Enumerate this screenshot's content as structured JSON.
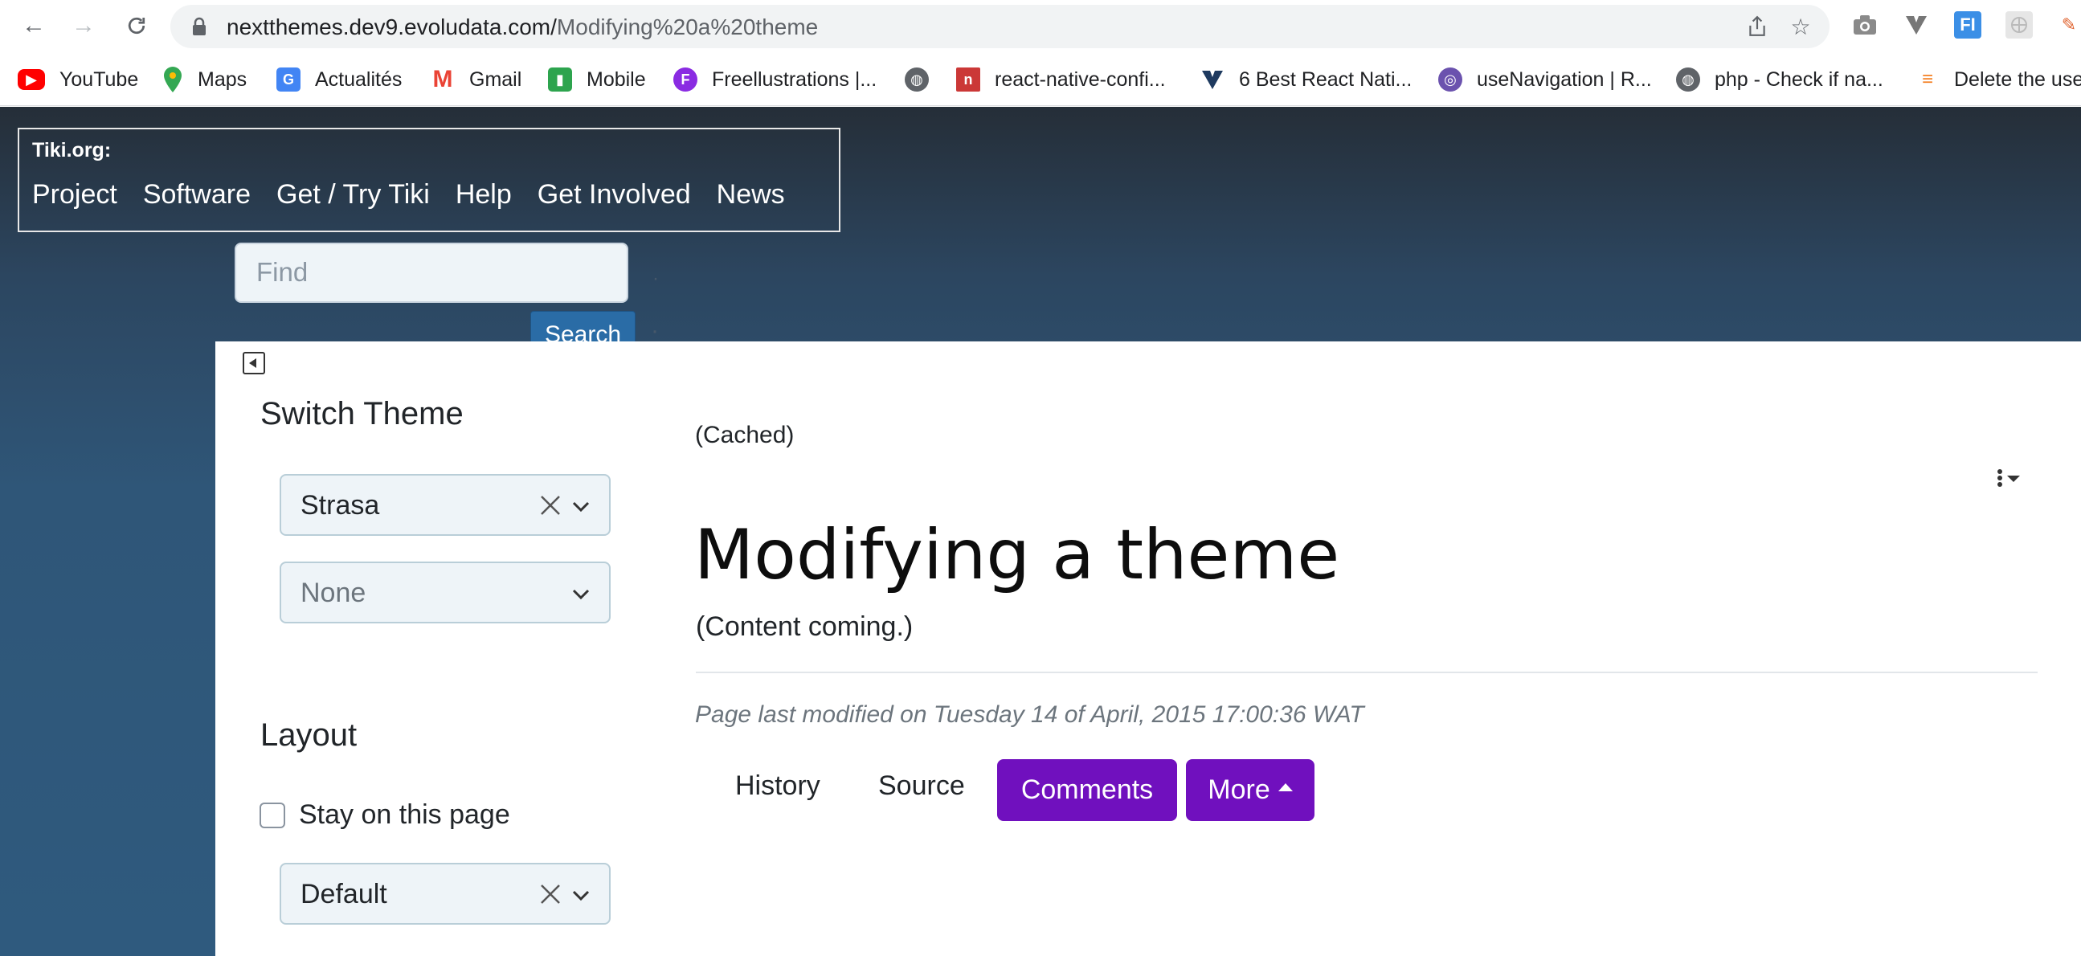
{
  "browser": {
    "url_host": "nextthemes.dev9.evoludata.com/",
    "url_path": "Modifying%20a%20theme",
    "bookmarks": [
      {
        "label": "YouTube",
        "icon": "youtube-icon",
        "color": "#ff0000"
      },
      {
        "label": "Maps",
        "icon": "maps-pin-icon",
        "color": "#34a853"
      },
      {
        "label": "Actualités",
        "icon": "news-icon",
        "color": "#4285f4"
      },
      {
        "label": "Gmail",
        "icon": "gmail-icon",
        "color": "#ea4335"
      },
      {
        "label": "Mobile",
        "icon": "mobile-icon",
        "color": "#2da44e"
      },
      {
        "label": "Freellustrations |...",
        "icon": "freellustrations-icon",
        "color": "#8a2be2"
      },
      {
        "label": "",
        "icon": "globe-icon",
        "color": "#5f6368"
      },
      {
        "label": "react-native-confi...",
        "icon": "npm-icon",
        "color": "#cb3837"
      },
      {
        "label": "6 Best React Nati...",
        "icon": "vuetify-icon",
        "color": "#1e3a5f"
      },
      {
        "label": "useNavigation | R...",
        "icon": "react-navigation-icon",
        "color": "#6b52ae"
      },
      {
        "label": "php - Check if na...",
        "icon": "globe-icon",
        "color": "#5f6368"
      },
      {
        "label": "Delete the use",
        "icon": "stackoverflow-icon",
        "color": "#f48024"
      }
    ]
  },
  "site": {
    "label": "Tiki.org:",
    "menu": [
      "Project",
      "Software",
      "Get / Try Tiki",
      "Help",
      "Get Involved",
      "News"
    ],
    "search_placeholder": "Find",
    "search_button": "Search"
  },
  "sidebar": {
    "switch_theme_heading": "Switch Theme",
    "theme_select_value": "Strasa",
    "option_select_value": "None",
    "layout_heading": "Layout",
    "stay_on_page_label": "Stay on this page",
    "layout_select_value": "Default"
  },
  "main": {
    "cached_label": "(Cached)",
    "title": "Modifying a theme",
    "content": "(Content coming.)",
    "last_modified": "Page last modified on Tuesday 14 of April, 2015 17:00:36 WAT",
    "actions": {
      "history": "History",
      "source": "Source",
      "comments": "Comments",
      "more": "More"
    }
  },
  "colors": {
    "accent_purple": "#7010be",
    "search_blue": "#2a6ca6"
  }
}
